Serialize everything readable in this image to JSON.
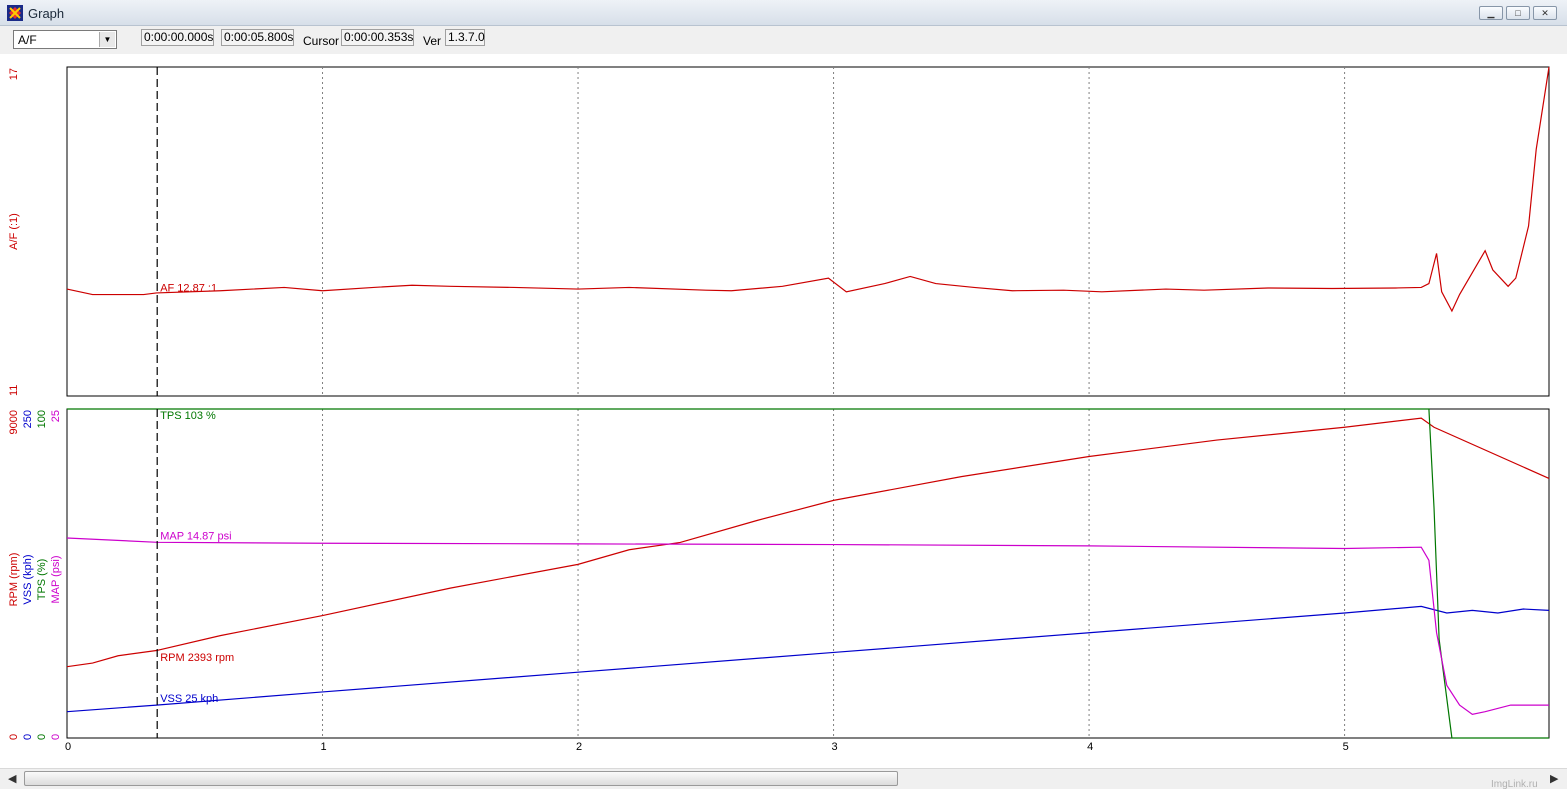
{
  "window": {
    "title": "Graph",
    "minimize": "▁",
    "maximize": "□",
    "close": "✕"
  },
  "toolbar": {
    "channel_select": "A/F",
    "start_time": "0:00:00.000s",
    "end_time": "0:00:05.800s",
    "cursor_label": "Cursor",
    "cursor_time": "0:00:00.353s",
    "ver_label": "Ver",
    "ver_value": "1.3.7.0"
  },
  "colors": {
    "af": "#cc0000",
    "rpm": "#cc0000",
    "vss": "#0000cc",
    "tps": "#007700",
    "map": "#cc00cc",
    "grid": "#808080"
  },
  "chart_data": [
    {
      "type": "line",
      "ylabel": "A/F (:1)",
      "ylim": [
        11,
        17
      ],
      "y_ticks": [
        "17",
        "11"
      ],
      "xlim": [
        0,
        5.8
      ],
      "x_ticks": [
        "0",
        "1",
        "2",
        "3",
        "4",
        "5"
      ],
      "cursor_x": 0.353,
      "cursor_label": "AF 12.87 :1",
      "series": [
        {
          "name": "AF",
          "color": "#cc0000",
          "x": [
            0,
            0.1,
            0.3,
            0.35,
            0.6,
            0.85,
            1.0,
            1.2,
            1.35,
            1.5,
            1.75,
            2.0,
            2.2,
            2.5,
            2.6,
            2.8,
            2.98,
            3.05,
            3.2,
            3.3,
            3.4,
            3.55,
            3.7,
            3.9,
            4.05,
            4.3,
            4.45,
            4.7,
            4.95,
            5.2,
            5.3,
            5.33,
            5.36,
            5.38,
            5.42,
            5.45,
            5.55,
            5.58,
            5.64,
            5.67,
            5.72,
            5.75,
            5.8
          ],
          "y": [
            12.95,
            12.85,
            12.85,
            12.88,
            12.92,
            12.98,
            12.92,
            12.98,
            13.02,
            13.0,
            12.98,
            12.95,
            12.98,
            12.93,
            12.92,
            13.0,
            13.15,
            12.9,
            13.05,
            13.18,
            13.05,
            12.98,
            12.92,
            12.93,
            12.9,
            12.95,
            12.93,
            12.97,
            12.96,
            12.97,
            12.98,
            13.05,
            13.6,
            12.9,
            12.55,
            12.85,
            13.65,
            13.3,
            13.0,
            13.15,
            14.1,
            15.5,
            17.0
          ]
        }
      ]
    },
    {
      "type": "line",
      "axes": [
        {
          "label": "RPM (rpm)",
          "max": "9000",
          "min": "0",
          "color": "#cc0000"
        },
        {
          "label": "VSS (kph)",
          "max": "250",
          "min": "0",
          "color": "#0000cc"
        },
        {
          "label": "TPS (%)",
          "max": "100",
          "min": "0",
          "color": "#007700"
        },
        {
          "label": "MAP (psi)",
          "max": "25",
          "min": "0",
          "color": "#cc00cc"
        }
      ],
      "xlim": [
        0,
        5.8
      ],
      "cursor_x": 0.353,
      "series": [
        {
          "name": "RPM",
          "label": "RPM 2393 rpm",
          "color": "#cc0000",
          "ymax": 9000,
          "x": [
            0,
            0.1,
            0.2,
            0.35,
            0.6,
            1.0,
            1.5,
            2.0,
            2.2,
            2.4,
            2.7,
            3.0,
            3.5,
            4.0,
            4.5,
            5.0,
            5.3,
            5.35,
            5.8
          ],
          "y": [
            1950,
            2050,
            2250,
            2393,
            2800,
            3350,
            4100,
            4750,
            5150,
            5350,
            5950,
            6500,
            7150,
            7700,
            8150,
            8500,
            8750,
            8500,
            7100
          ]
        },
        {
          "name": "VSS",
          "label": "VSS 25 kph",
          "color": "#0000cc",
          "ymax": 250,
          "x": [
            0,
            0.35,
            1.0,
            2.0,
            3.0,
            4.0,
            5.0,
            5.3,
            5.4,
            5.5,
            5.6,
            5.7,
            5.8
          ],
          "y": [
            20,
            25,
            35,
            50,
            65,
            80,
            95,
            100,
            95,
            97,
            95,
            98,
            97
          ]
        },
        {
          "name": "TPS",
          "label": "TPS 103 %",
          "color": "#007700",
          "ymax": 100,
          "x": [
            0,
            5.3,
            5.33,
            5.35,
            5.37,
            5.42,
            5.8
          ],
          "y": [
            103,
            103,
            100,
            70,
            30,
            0,
            0
          ]
        },
        {
          "name": "MAP",
          "label": "MAP 14.87 psi",
          "color": "#cc00cc",
          "ymax": 25,
          "x": [
            0,
            0.353,
            1.0,
            2.0,
            3.0,
            4.0,
            5.0,
            5.3,
            5.33,
            5.36,
            5.4,
            5.45,
            5.5,
            5.55,
            5.65,
            5.8
          ],
          "y": [
            15.2,
            14.87,
            14.8,
            14.75,
            14.7,
            14.6,
            14.4,
            14.5,
            13.5,
            8.0,
            4.0,
            2.5,
            1.8,
            2.0,
            2.5,
            2.5
          ]
        }
      ]
    }
  ],
  "watermark": "ImgLink.ru"
}
